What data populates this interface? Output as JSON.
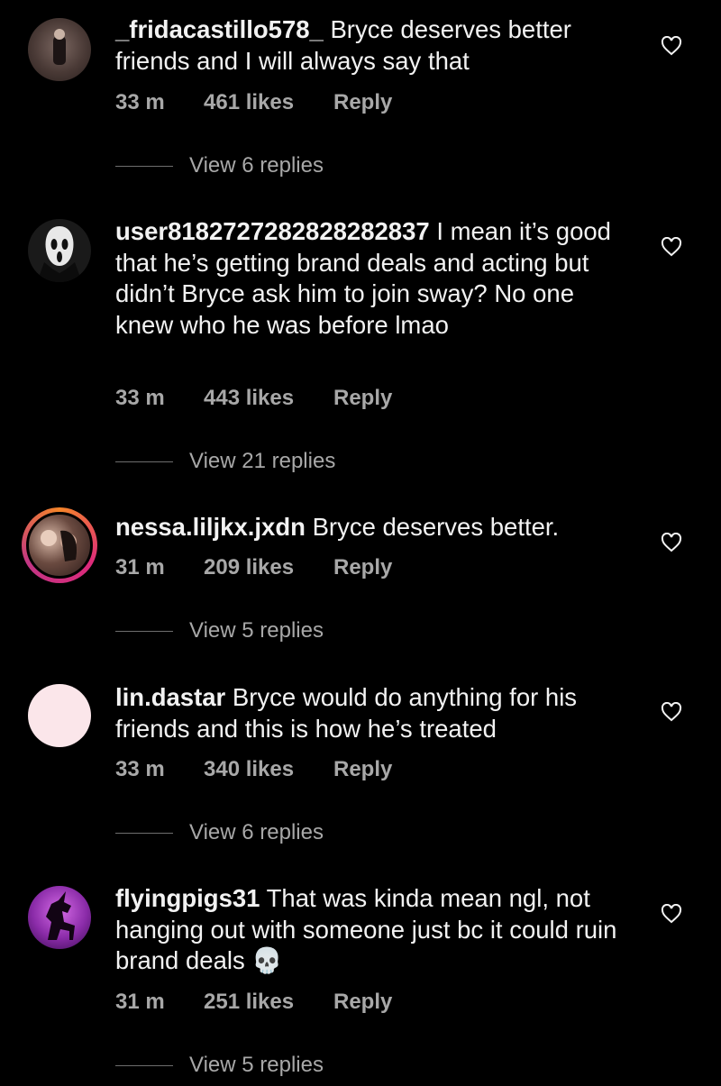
{
  "comments": [
    {
      "username": "_fridacastillo578_",
      "text": "Bryce deserves better friends and I will always say that",
      "time": "33 m",
      "likes": "461 likes",
      "reply": "Reply",
      "view_replies": "View 6 replies",
      "avatar_icon": "photo-avatar"
    },
    {
      "username": "user8182727282828282837",
      "text": "I mean it’s good that he’s getting brand deals and acting but didn’t Bryce ask him to join sway? No one knew who he was before lmao",
      "time": "33 m",
      "likes": "443 likes",
      "reply": "Reply",
      "view_replies": "View 21 replies",
      "avatar_icon": "ghostface-avatar"
    },
    {
      "username": "nessa.liljkx.jxdn",
      "text": "Bryce deserves better.",
      "time": "31 m",
      "likes": "209 likes",
      "reply": "Reply",
      "view_replies": "View 5 replies",
      "avatar_icon": "story-ring-avatar"
    },
    {
      "username": "lin.dastar",
      "text": "Bryce would do anything for his friends and this is how he’s treated",
      "time": "33 m",
      "likes": "340 likes",
      "reply": "Reply",
      "view_replies": "View 6 replies",
      "avatar_icon": "blank-pink-avatar"
    },
    {
      "username": "flyingpigs31",
      "text": "That was kinda mean ngl, not hanging out with someone just bc it could ruin brand deals 💀",
      "time": "31 m",
      "likes": "251 likes",
      "reply": "Reply",
      "view_replies": "View 5 replies",
      "avatar_icon": "unicorn-avatar"
    }
  ],
  "colors": {
    "background": "#000000",
    "text": "#f2f2f2",
    "muted": "#a8a8a8",
    "story_ring": "#dd2a7b"
  }
}
